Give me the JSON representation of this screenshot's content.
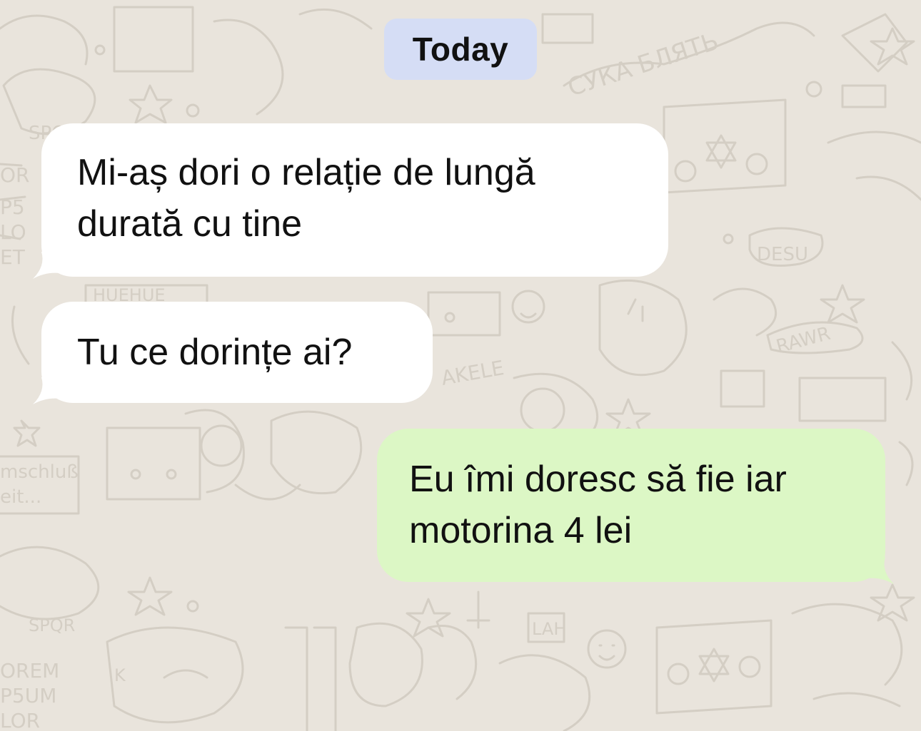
{
  "chat": {
    "date_separator": "Today",
    "wallpaper": {
      "background_color": "#e9e4dc",
      "doodle_color": "#d6d0c6"
    },
    "messages": [
      {
        "direction": "incoming",
        "text": "Mi-aș dori o relație de lungă durată cu tine",
        "bubble_color": "#ffffff"
      },
      {
        "direction": "incoming",
        "text": "Tu ce dorințe ai?",
        "bubble_color": "#ffffff"
      },
      {
        "direction": "outgoing",
        "text": "Eu îmi doresc să fie iar motorina 4 lei",
        "bubble_color": "#dcf7c5"
      }
    ],
    "date_pill_color": "#d5ddf5"
  }
}
